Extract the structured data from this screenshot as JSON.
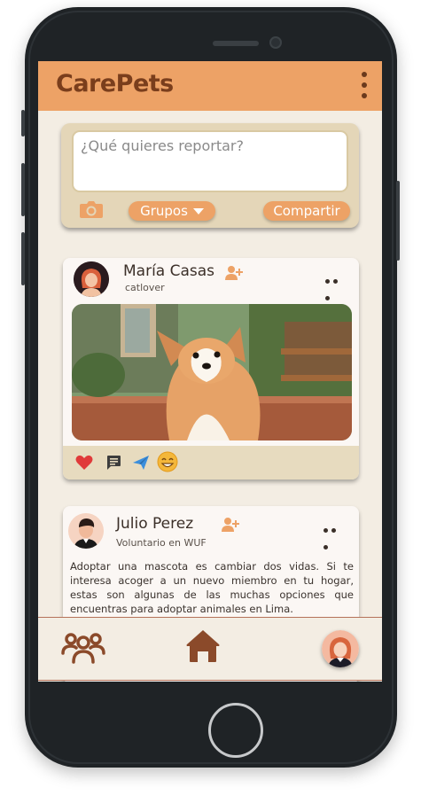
{
  "app": {
    "title": "CarePets"
  },
  "report": {
    "placeholder": "¿Qué quieres reportar?",
    "groups_label": "Grupos",
    "share_label": "Compartir"
  },
  "posts": [
    {
      "name": "María Casas",
      "subtitle": "catlover"
    },
    {
      "name": "Julio Perez",
      "subtitle": "Voluntario en WUF",
      "text": "Adoptar una mascota es cambiar dos vidas. Si te interesa acoger a un nuevo miembro en tu hogar, estas son algunas de las muchas opciones que encuentras para adoptar animales en Lima."
    }
  ],
  "colors": {
    "accent": "#eda266",
    "brand": "#7a3e1c",
    "background": "#f3ede3"
  },
  "icons": [
    "camera-icon",
    "chevron-down-icon",
    "add-friend-icon",
    "more-icon",
    "heart-icon",
    "comment-icon",
    "send-icon",
    "smile-icon",
    "groups-icon",
    "home-icon"
  ]
}
